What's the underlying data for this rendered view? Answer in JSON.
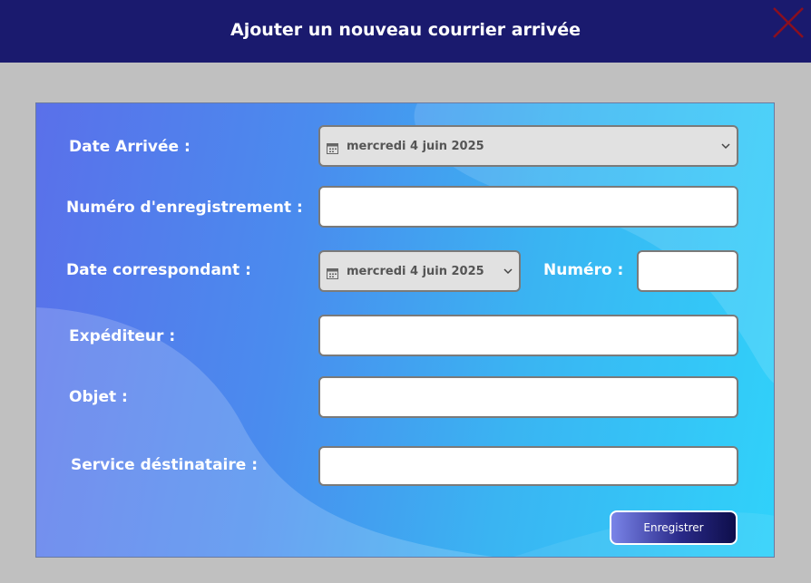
{
  "window": {
    "title": "Ajouter un nouveau courrier arrivée",
    "close_icon": "close-icon",
    "close_color": "#8b0f1f"
  },
  "form": {
    "date_arrivee": {
      "label": "Date Arrivée :",
      "value": "mercredi 4 juin 2025",
      "icon": "calendar-icon"
    },
    "numero_enregistrement": {
      "label": "Numéro d'enregistrement :",
      "value": ""
    },
    "date_correspondant": {
      "label": "Date correspondant :",
      "value": "mercredi 4 juin 2025",
      "icon": "calendar-icon"
    },
    "numero": {
      "label": "Numéro :",
      "value": ""
    },
    "expediteur": {
      "label": "Expéditeur :",
      "value": ""
    },
    "objet": {
      "label": "Objet :",
      "value": ""
    },
    "service_destinataire": {
      "label": "Service déstinataire :",
      "value": ""
    }
  },
  "actions": {
    "save_label": "Enregistrer"
  },
  "colors": {
    "title_bar": "#1a1a6e",
    "gradient_start": "#5a70ea",
    "gradient_end": "#30d2fa",
    "window_bg": "#c0c0c0"
  }
}
